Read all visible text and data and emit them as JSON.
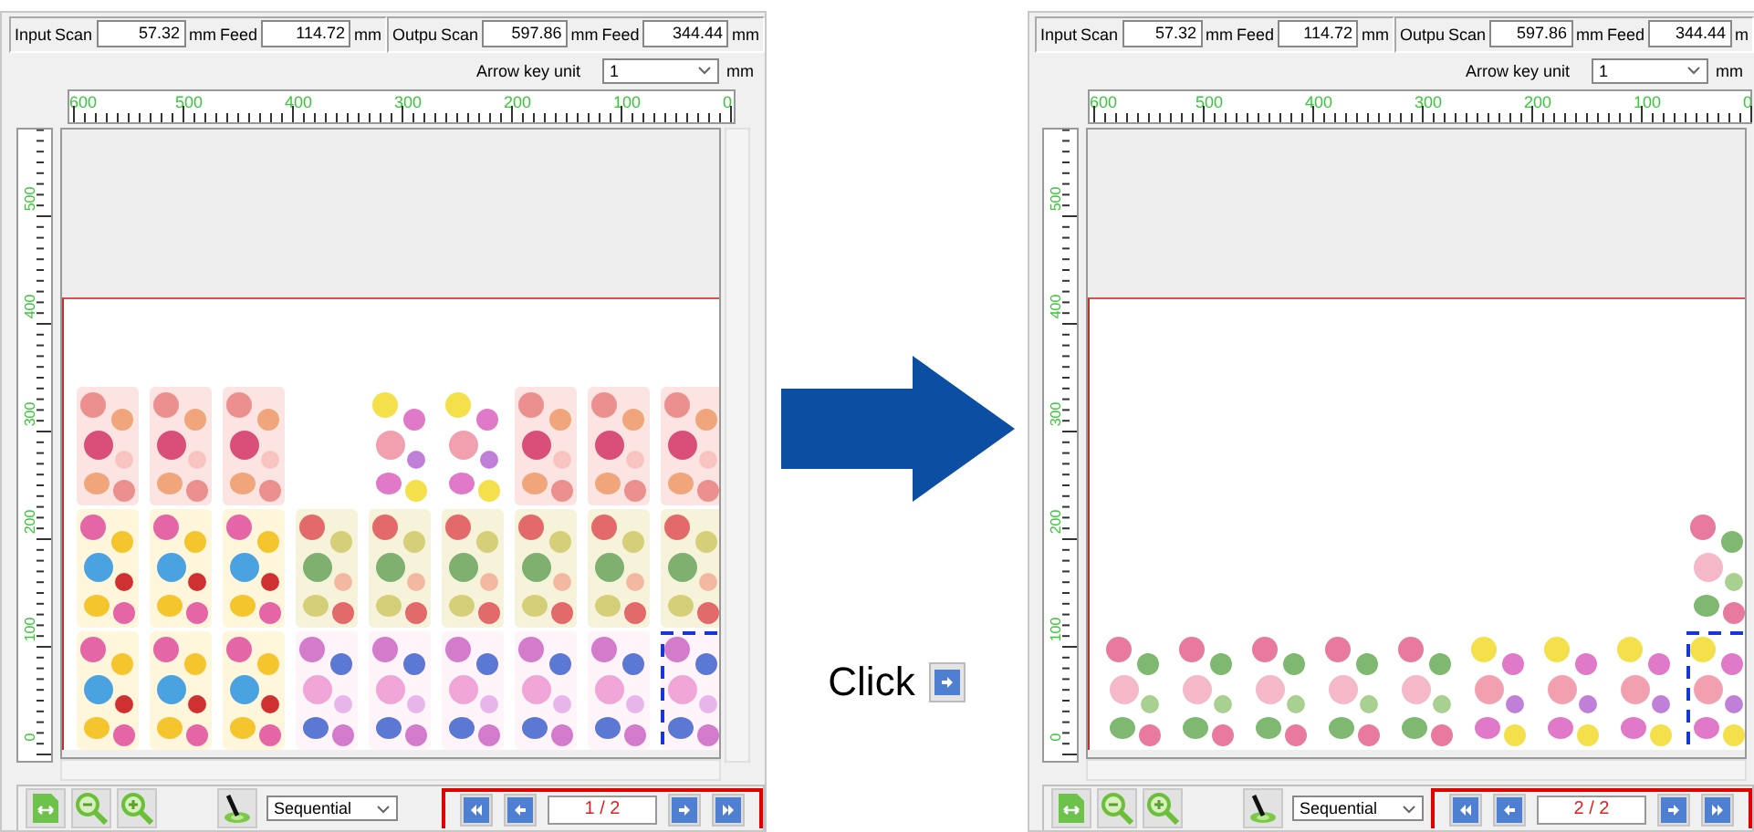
{
  "panels": [
    {
      "coords": {
        "input": {
          "label": "Input",
          "scan_label": "Scan",
          "scan": "57.32",
          "scan_unit": "mm",
          "feed_label": "Feed",
          "feed": "114.72",
          "feed_unit": "mm"
        },
        "output": {
          "label": "Outpu",
          "scan_label": "Scan",
          "scan": "597.86",
          "scan_unit": "mm",
          "feed_label": "Feed",
          "feed": "344.44",
          "feed_unit": "mm"
        }
      },
      "arrow_key": {
        "label": "Arrow key unit",
        "value": "1",
        "unit": "mm"
      },
      "x_ruler": [
        "600",
        "500",
        "400",
        "300",
        "200",
        "100",
        "0"
      ],
      "y_ruler": [
        "500",
        "400",
        "300",
        "200",
        "100",
        "0"
      ],
      "columns": [
        [
          {
            "kind": "picture",
            "selected": false
          },
          {
            "kind": "picture",
            "selected": false
          },
          {
            "kind": "picture",
            "selected": false
          }
        ],
        [
          {
            "kind": "picture",
            "selected": false
          },
          {
            "kind": "picture",
            "selected": false
          },
          {
            "kind": "picture",
            "selected": false
          }
        ],
        [
          {
            "kind": "picture",
            "selected": false
          },
          {
            "kind": "picture",
            "selected": false
          },
          {
            "kind": "picture",
            "selected": false
          }
        ],
        [
          {
            "kind": "picture",
            "selected": false
          },
          {
            "kind": "picture",
            "selected": false
          }
        ],
        [
          {
            "kind": "picture",
            "selected": false
          },
          {
            "kind": "picture",
            "selected": false
          },
          {
            "kind": "picture",
            "selected": false
          }
        ],
        [
          {
            "kind": "picture",
            "selected": false
          },
          {
            "kind": "picture",
            "selected": false
          },
          {
            "kind": "picture",
            "selected": false
          }
        ],
        [
          {
            "kind": "picture",
            "selected": false
          },
          {
            "kind": "picture",
            "selected": false
          },
          {
            "kind": "picture",
            "selected": false
          }
        ],
        [
          {
            "kind": "picture",
            "selected": false
          },
          {
            "kind": "picture",
            "selected": false
          },
          {
            "kind": "picture",
            "selected": false
          }
        ],
        [
          {
            "kind": "picture",
            "selected": false
          },
          {
            "kind": "picture",
            "selected": false
          },
          {
            "kind": "picture",
            "selected": true
          }
        ]
      ],
      "order": "Sequential",
      "page": "1 / 2"
    },
    {
      "coords": {
        "input": {
          "label": "Input",
          "scan_label": "Scan",
          "scan": "57.32",
          "scan_unit": "mm",
          "feed_label": "Feed",
          "feed": "114.72",
          "feed_unit": "mm"
        },
        "output": {
          "label": "Outpu",
          "scan_label": "Scan",
          "scan": "597.86",
          "scan_unit": "mm",
          "feed_label": "Feed",
          "feed": "344.44",
          "feed_unit": "m"
        }
      },
      "arrow_key": {
        "label": "Arrow key unit",
        "value": "1",
        "unit": "mm"
      },
      "x_ruler": [
        "600",
        "500",
        "400",
        "300",
        "200",
        "100",
        "0"
      ],
      "y_ruler": [
        "500",
        "400",
        "300",
        "200",
        "100",
        "0"
      ],
      "columns": [
        [
          {
            "kind": "picture",
            "selected": false
          }
        ],
        [
          {
            "kind": "picture",
            "selected": false
          }
        ],
        [
          {
            "kind": "picture",
            "selected": false
          }
        ],
        [
          {
            "kind": "picture",
            "selected": false
          }
        ],
        [
          {
            "kind": "picture",
            "selected": false
          }
        ],
        [
          {
            "kind": "picture",
            "selected": false
          }
        ],
        [
          {
            "kind": "picture",
            "selected": false
          }
        ],
        [
          {
            "kind": "picture",
            "selected": false
          }
        ],
        [
          {
            "kind": "picture",
            "selected": false
          },
          {
            "kind": "picture",
            "selected": true
          }
        ]
      ],
      "order": "Sequential",
      "page": "2 / 2"
    }
  ],
  "instruction": {
    "label": "Click"
  }
}
